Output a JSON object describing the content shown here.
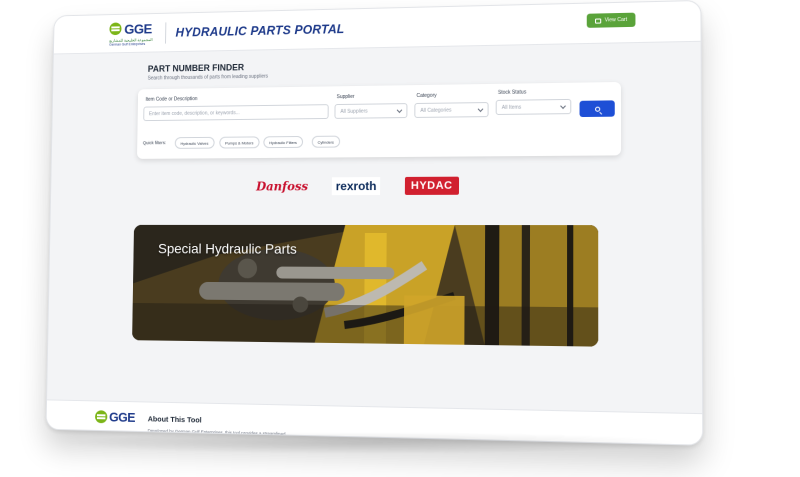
{
  "header": {
    "logo_text": "GGE",
    "logo_sub_arabic": "المجموعة الخليجية للمشاريع",
    "logo_sub_english": "German Gulf Enterprises",
    "portal_title": "HYDRAULIC PARTS PORTAL",
    "cart_label": "View Cart"
  },
  "finder": {
    "title": "PART NUMBER FINDER",
    "subtitle": "Search through thousands of parts from leading suppliers",
    "item_label": "Item Code or Description",
    "item_placeholder": "Enter item code, description, or keywords...",
    "supplier_label": "Supplier",
    "supplier_value": "All Suppliers",
    "category_label": "Category",
    "category_value": "All Categories",
    "stock_label": "Stock Status",
    "stock_value": "All Items",
    "quick_filters_label": "Quick filters:",
    "quick_filters": [
      "Hydraulic Valves",
      "Pumps & Motors",
      "Hydraulic Filters",
      "Cylinders"
    ]
  },
  "brands": {
    "danfoss": "Danfoss",
    "rexroth": "rexroth",
    "hydac": "HYDAC"
  },
  "hero": {
    "title": "Special Hydraulic Parts"
  },
  "footer": {
    "logo_text": "GGE",
    "about_title": "About This Tool",
    "about_text": "Developed by German Gulf Enterprises, this tool provides a streamlined"
  }
}
